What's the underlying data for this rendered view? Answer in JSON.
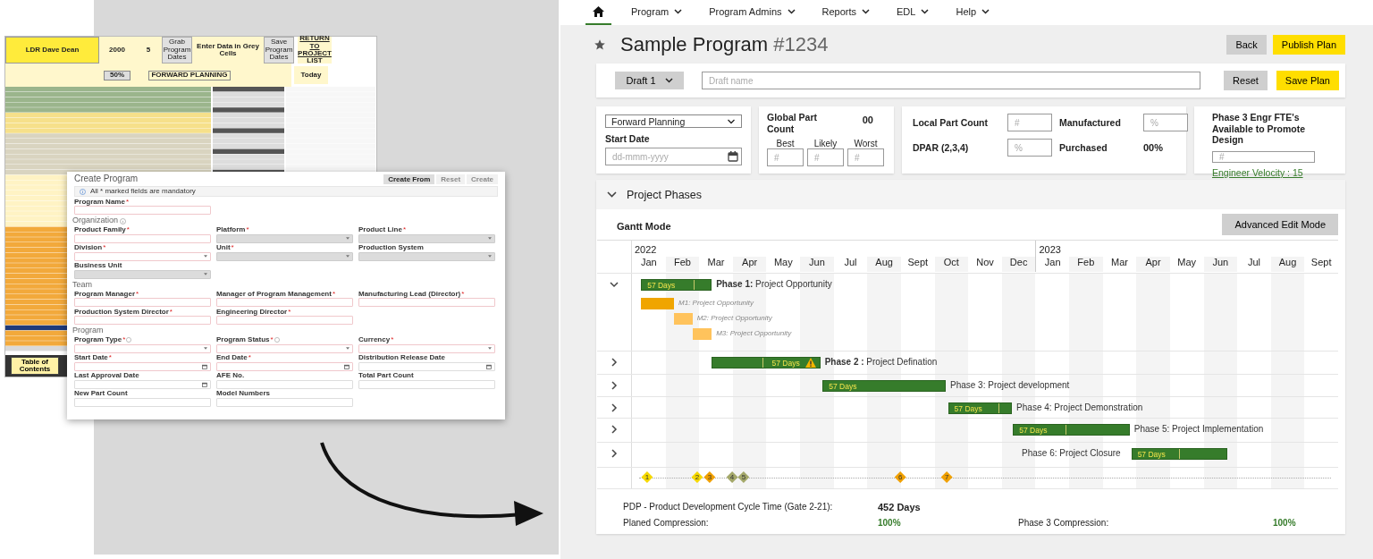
{
  "spreadsheet": {
    "owner": "LDR Dave Dean",
    "year": "2000",
    "count": "5",
    "grab_button": "Grab Program Dates",
    "hint": "Enter Data in Grey Cells",
    "save_button": "Save Program Dates",
    "return_link": "RETURN TO PROJECT LIST",
    "today_label": "Today",
    "mode": "FORWARD PLANNING",
    "percent": "50%",
    "sheet_tab": "Table of Contents"
  },
  "create_form": {
    "title": "Create Program",
    "buttons": [
      {
        "label": "Create From",
        "disabled": false
      },
      {
        "label": "Reset",
        "disabled": true
      },
      {
        "label": "Create",
        "disabled": true
      }
    ],
    "notice": "All * marked fields are mandatory",
    "sections": [
      {
        "rows": [
          {
            "fields": [
              {
                "label": "Program Name",
                "mark": "*",
                "kind": "text",
                "info": false,
                "disabled": false
              }
            ]
          }
        ]
      },
      {
        "title": "Organization",
        "info": true,
        "rows": [
          {
            "fields": [
              {
                "label": "Product Family",
                "mark": "*",
                "kind": "text",
                "info": false,
                "disabled": false
              },
              {
                "label": "Platform",
                "mark": "*",
                "kind": "select",
                "info": false,
                "disabled": true
              },
              {
                "label": "Product Line",
                "mark": "*",
                "kind": "select",
                "info": false,
                "disabled": true
              }
            ]
          },
          {
            "fields": [
              {
                "label": "Division",
                "mark": "*",
                "kind": "select",
                "info": false,
                "disabled": false
              },
              {
                "label": "Unit",
                "mark": "*",
                "kind": "select",
                "info": false,
                "disabled": true
              },
              {
                "label": "Production System",
                "kind": "select",
                "info": false,
                "disabled": true
              }
            ]
          },
          {
            "fields": [
              {
                "label": "Business Unit",
                "kind": "select",
                "info": false,
                "disabled": true
              }
            ]
          }
        ]
      },
      {
        "title": "Team",
        "info": false,
        "rows": [
          {
            "fields": [
              {
                "label": "Program Manager",
                "mark": "*",
                "kind": "text",
                "info": false,
                "disabled": false
              },
              {
                "label": "Manager of Program Management",
                "mark": "*",
                "kind": "text",
                "info": false,
                "disabled": false
              },
              {
                "label": "Manufacturing Lead (Director)",
                "mark": "*",
                "kind": "text",
                "info": false,
                "disabled": false
              }
            ]
          },
          {
            "fields": [
              {
                "label": "Production System Director",
                "mark": "*",
                "kind": "text",
                "info": false,
                "disabled": false
              },
              {
                "label": "Engineering Director",
                "mark": "*",
                "kind": "text",
                "info": false,
                "disabled": false
              }
            ]
          }
        ]
      },
      {
        "title": "Program",
        "info": false,
        "rows": [
          {
            "fields": [
              {
                "label": "Program Type",
                "mark": "*",
                "kind": "select",
                "info": true,
                "disabled": false
              },
              {
                "label": "Program Status",
                "mark": "*",
                "kind": "select",
                "info": true,
                "disabled": false
              },
              {
                "label": "Currency",
                "mark": "*",
                "kind": "select",
                "info": false,
                "disabled": false
              }
            ]
          },
          {
            "fields": [
              {
                "label": "Start Date",
                "mark": "*",
                "kind": "date",
                "info": false,
                "disabled": false
              },
              {
                "label": "End Date",
                "mark": "*",
                "kind": "date",
                "info": false,
                "disabled": false
              },
              {
                "label": "Distribution Release Date",
                "kind": "date",
                "info": false,
                "disabled": false
              }
            ]
          },
          {
            "fields": [
              {
                "label": "Last Approval Date",
                "kind": "date",
                "info": false,
                "disabled": false
              },
              {
                "label": "AFE No.",
                "kind": "text",
                "info": false,
                "disabled": false
              },
              {
                "label": "Total Part Count",
                "kind": "text",
                "info": false,
                "disabled": false
              }
            ]
          },
          {
            "fields": [
              {
                "label": "New Part Count",
                "kind": "text",
                "info": false,
                "disabled": false
              },
              {
                "label": "Model Numbers",
                "kind": "text",
                "info": false,
                "disabled": false
              }
            ]
          }
        ]
      }
    ]
  },
  "nav": {
    "items": [
      {
        "kind": "home",
        "selected": true
      },
      {
        "kind": "menu",
        "label": "Program",
        "selected": false
      },
      {
        "kind": "menu",
        "label": "Program Admins",
        "selected": false
      },
      {
        "kind": "menu",
        "label": "Reports",
        "selected": false
      },
      {
        "kind": "menu",
        "label": "EDL",
        "selected": false
      },
      {
        "kind": "menu",
        "label": "Help",
        "selected": false
      }
    ]
  },
  "title": {
    "name": "Sample Program",
    "number": "#1234",
    "actions": [
      {
        "label": "Back",
        "kind": "secondary"
      },
      {
        "label": "Publish Plan",
        "kind": "primary"
      }
    ]
  },
  "draft": {
    "select": "Draft 1",
    "placeholder": "Draft name",
    "buttons": [
      {
        "label": "Reset",
        "kind": "secondary"
      },
      {
        "label": "Save Plan",
        "kind": "primary"
      }
    ]
  },
  "planning": {
    "mode": "Forward Planning",
    "start_date_label": "Start Date",
    "start_date_placeholder": "dd-mmm-yyyy"
  },
  "global_part_count": {
    "label": "Global Part Count",
    "value": "00",
    "fields": [
      {
        "label": "Best",
        "placeholder": "#"
      },
      {
        "label": "Likely",
        "placeholder": "#"
      },
      {
        "label": "Worst",
        "placeholder": "#"
      }
    ]
  },
  "counts": {
    "local_part_count": {
      "label": "Local Part Count",
      "placeholder": "#"
    },
    "manufactured": {
      "label": "Manufactured",
      "placeholder": "%"
    },
    "dpar": {
      "label": "DPAR (2,3,4)",
      "placeholder": "%"
    },
    "purchased": {
      "label": "Purchased",
      "value": "00%"
    }
  },
  "fte": {
    "label": "Phase 3 Engr FTE's Available to Promote Design",
    "placeholder": "#",
    "link": "Engineer Velocity : 15"
  },
  "phases_panel": {
    "title": "Project Phases",
    "expanded": true,
    "gantt_title": "Gantt Mode",
    "button": "Advanced Edit Mode",
    "years": [
      "2022",
      "2023"
    ],
    "months": [
      "Jan",
      "Feb",
      "Mar",
      "Apr",
      "May",
      "Jun",
      "Jul",
      "Aug",
      "Sept",
      "Oct",
      "Nov",
      "Dec",
      "Jan",
      "Feb",
      "Mar",
      "Apr",
      "May",
      "Jun",
      "Jul",
      "Aug",
      "Sept"
    ],
    "phases": [
      {
        "label": "**Phase 1:** Project Opportunity",
        "bar": "57 Days",
        "expanded": true,
        "warning": false,
        "children": [
          {
            "label": "M1: Project Opportunity",
            "color": "#f0a500"
          },
          {
            "label": "M2: Project Opportunity",
            "color": "#ffc35c"
          },
          {
            "label": "M3: Project Opportunity",
            "color": "#ffc35c"
          }
        ]
      },
      {
        "label": "**Phase 2 :** Project Defination",
        "bar": "57 Days",
        "expanded": false,
        "warning": true
      },
      {
        "label": "Phase 3: Project development",
        "bar": "57 Days",
        "expanded": false,
        "warning": false
      },
      {
        "label": "Phase 4: Project Demonstration",
        "bar": "57 Days",
        "expanded": false,
        "warning": false
      },
      {
        "label": "Phase 5: Project Implementation",
        "bar": "57 Days",
        "expanded": false,
        "warning": false
      },
      {
        "label": "Phase 6: Project Closure",
        "bar": "57 Days",
        "expanded": false,
        "warning": false
      }
    ],
    "milestones": [
      {
        "label": "1",
        "color": "#f5d800"
      },
      {
        "label": "2",
        "color": "#f5d800"
      },
      {
        "label": "3",
        "color": "#f0a000"
      },
      {
        "label": "4",
        "color": "#a4a86a"
      },
      {
        "label": "5",
        "color": "#a4a86a"
      },
      {
        "label": "6",
        "color": "#f0a000"
      },
      {
        "label": "7",
        "color": "#f0a000"
      }
    ],
    "stat_rows": [
      {
        "items": [
          {
            "label": "PDP - Product Development Cycle Time (Gate 2-21):",
            "value": "452 Days",
            "kind": "bold"
          }
        ]
      },
      {
        "items": [
          {
            "label": "Planed Compression:",
            "value": "100%",
            "kind": "good"
          },
          {
            "label": "Phase 3 Compression:",
            "value": "100%",
            "kind": "good"
          }
        ]
      }
    ]
  }
}
